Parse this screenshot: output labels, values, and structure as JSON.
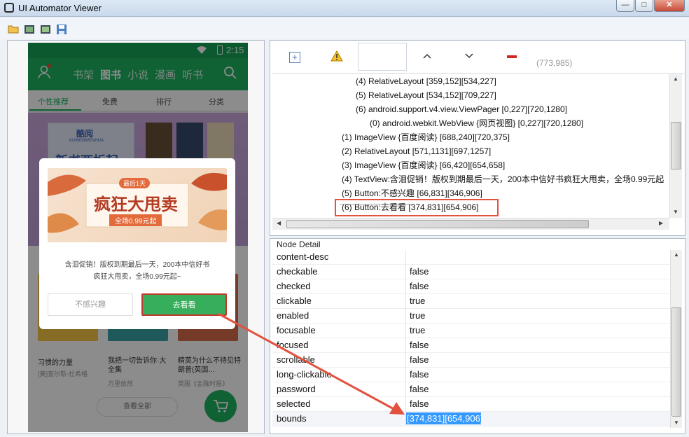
{
  "window": {
    "title": "UI Automator Viewer",
    "min": "—",
    "max": "□",
    "close": "✕"
  },
  "toolbar_icons": [
    "open-folder-icon",
    "device-screenshot-icon",
    "device-screenshot-compressed-icon",
    "save-icon"
  ],
  "phone": {
    "time": "2:15",
    "nav": [
      "书架",
      "图书",
      "小说",
      "漫画",
      "听书"
    ],
    "tabs": [
      "个性推荐",
      "免费",
      "排行",
      "分类"
    ],
    "banner_brand": "酷阅",
    "banner_brand_sub": "KUWENWENHUA",
    "banner_headline": "新书两折起",
    "dialog": {
      "ribbon": "最后1天",
      "headline": "疯狂大甩卖",
      "price_tag": "全场0.99元起",
      "message": "含泪促销！版权到期最后一天，200本中信好书疯狂大甩卖，全场0.99元起~",
      "cancel": "不感兴趣",
      "confirm": "去看看"
    },
    "books": [
      {
        "title": "习惯的力量",
        "author": "[美]查尔斯·杜希格"
      },
      {
        "title": "我把一切告诉你·大全集",
        "author": "万里依然"
      },
      {
        "title": "精英为什么不待见特朗普(英国…",
        "author": "英国《金融时报》"
      }
    ],
    "view_all": "查看全部"
  },
  "tree_toolbar": {
    "coords": "(773,985)"
  },
  "tree": [
    {
      "indent": 120,
      "text": "(4) RelativeLayout [359,152][534,227]"
    },
    {
      "indent": 120,
      "text": "(5) RelativeLayout [534,152][709,227]"
    },
    {
      "indent": 120,
      "text": "(6) android.support.v4.view.ViewPager [0,227][720,1280]"
    },
    {
      "indent": 140,
      "text": "(0) android.webkit.WebView {网页视图} [0,227][720,1280]"
    },
    {
      "indent": 100,
      "text": "(1) ImageView {百度阅读} [688,240][720,375]"
    },
    {
      "indent": 100,
      "text": "(2) RelativeLayout [571,1131][697,1257]"
    },
    {
      "indent": 100,
      "text": "(3) ImageView {百度阅读} [66,420][654,658]"
    },
    {
      "indent": 100,
      "text": "(4) TextView:含泪促销！版权到期最后一天，200本中信好书疯狂大甩卖，全场0.99元起"
    },
    {
      "indent": 100,
      "text": "(5) Button:不感兴趣 [66,831][346,906]"
    },
    {
      "indent": 100,
      "text": "(6) Button:去看看 [374,831][654,906]"
    }
  ],
  "detail": {
    "header": "Node Detail",
    "rows": [
      {
        "key": "content-desc",
        "value": ""
      },
      {
        "key": "checkable",
        "value": "false"
      },
      {
        "key": "checked",
        "value": "false"
      },
      {
        "key": "clickable",
        "value": "true"
      },
      {
        "key": "enabled",
        "value": "true"
      },
      {
        "key": "focusable",
        "value": "true"
      },
      {
        "key": "focused",
        "value": "false"
      },
      {
        "key": "scrollable",
        "value": "false"
      },
      {
        "key": "long-clickable",
        "value": "false"
      },
      {
        "key": "password",
        "value": "false"
      },
      {
        "key": "selected",
        "value": "false"
      },
      {
        "key": "bounds",
        "value": "[374,831][654,906]"
      }
    ]
  },
  "colors": {
    "accent_green": "#1eb262",
    "highlight_red": "#e2523f",
    "selection_blue": "#3399ff"
  }
}
